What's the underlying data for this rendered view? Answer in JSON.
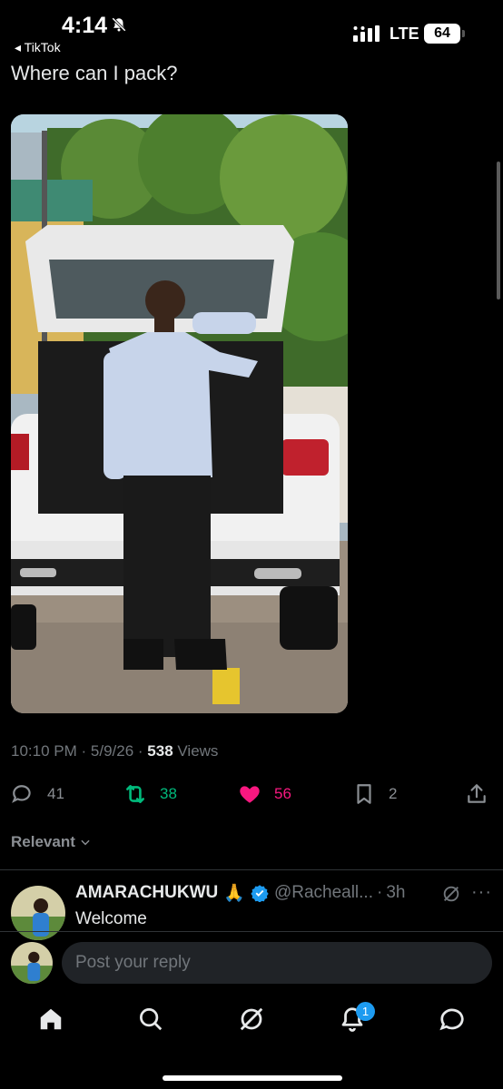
{
  "status": {
    "time": "4:14",
    "back_app": "◂ TikTok",
    "network": "LTE",
    "battery": "64"
  },
  "post": {
    "text": "Where can I pack?",
    "time": "10:10 PM",
    "date": "5/9/26",
    "views_count": "538",
    "views_label": "Views",
    "replies": "41",
    "reposts": "38",
    "likes": "56",
    "bookmarks": "2"
  },
  "sort": {
    "label": "Relevant"
  },
  "reply": {
    "name": "AMARACHUKWU",
    "emoji": "🙏",
    "handle": "@Racheall...",
    "separator": "·",
    "time": "3h",
    "more": "···",
    "text": "Welcome"
  },
  "compose": {
    "placeholder": "Post your reply"
  },
  "tabs": {
    "notifications_badge": "1"
  },
  "colors": {
    "repost": "#00ba7c",
    "like": "#f91880",
    "verified": "#1d9bf0",
    "muted": "#71767b"
  }
}
